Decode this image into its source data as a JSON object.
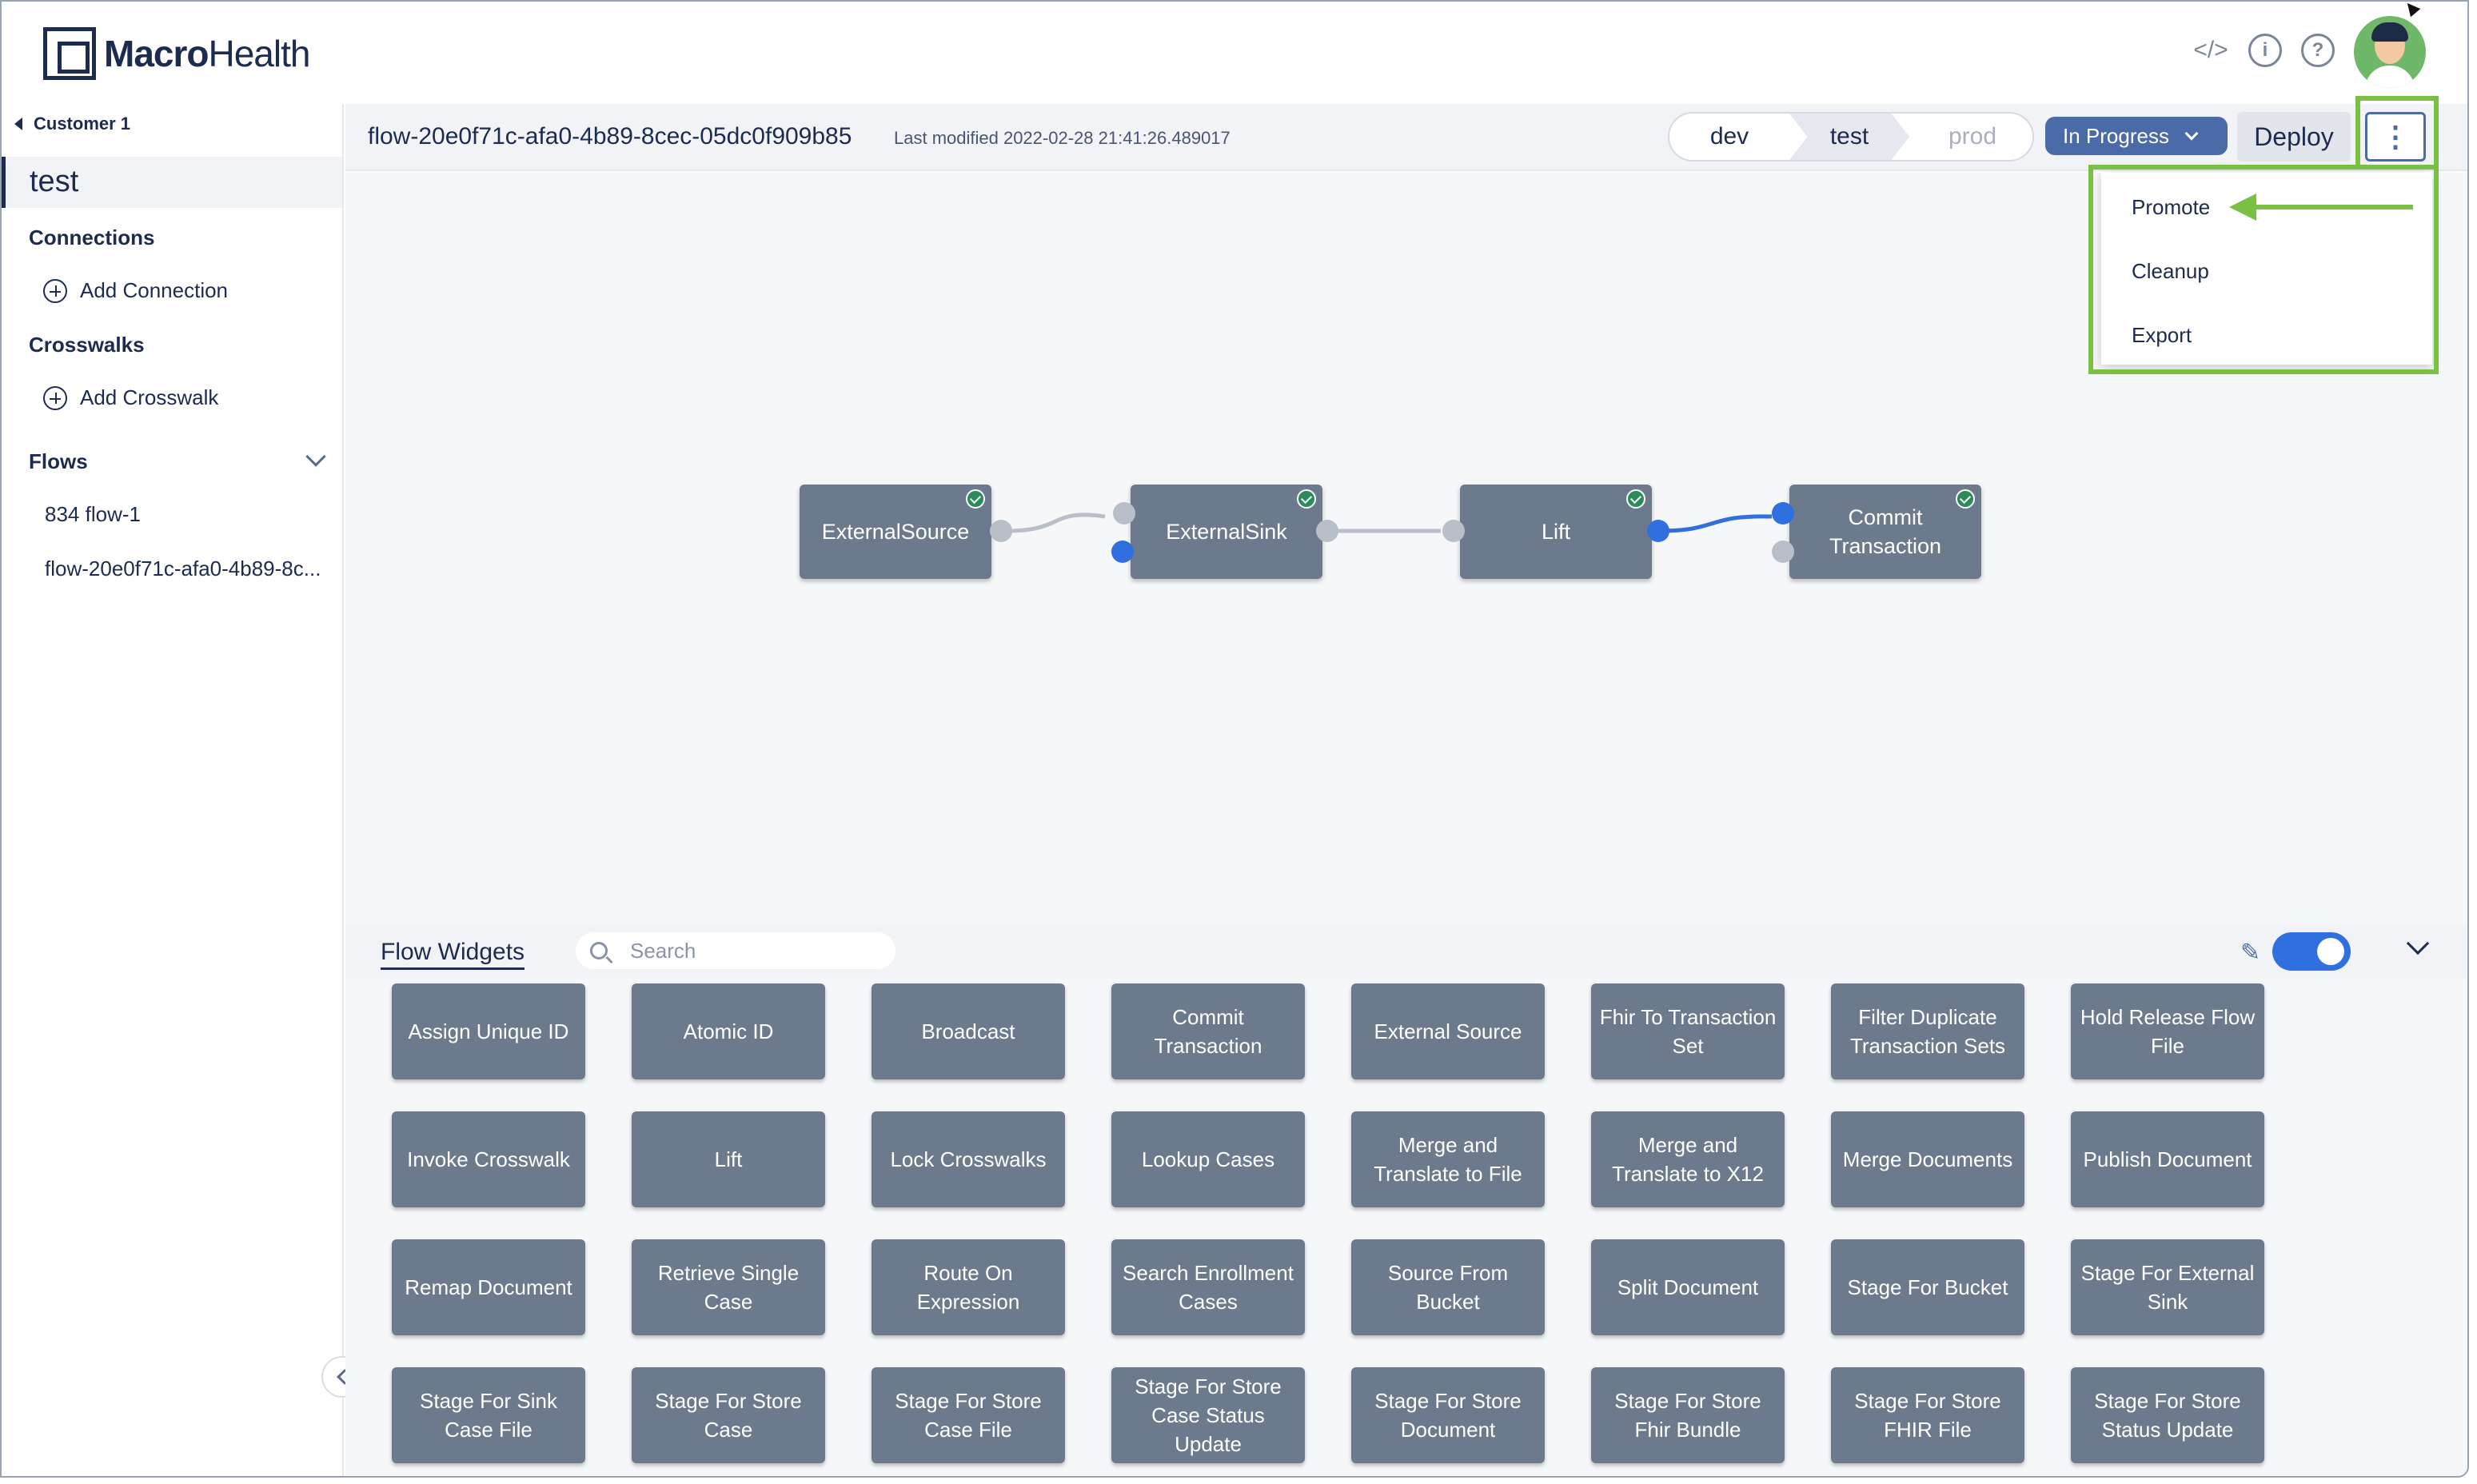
{
  "header": {
    "logo_text_bold": "Macro",
    "logo_text_light": "Health"
  },
  "sidebar": {
    "customer": "Customer 1",
    "active_item": "test",
    "connections_heading": "Connections",
    "add_connection": "Add Connection",
    "crosswalks_heading": "Crosswalks",
    "add_crosswalk": "Add Crosswalk",
    "flows_heading": "Flows",
    "flows": [
      "834 flow-1",
      "flow-20e0f71c-afa0-4b89-8c..."
    ]
  },
  "toolbar": {
    "flow_id": "flow-20e0f71c-afa0-4b89-8cec-05dc0f909b85",
    "last_modified": "Last modified 2022-02-28 21:41:26.489017",
    "env": {
      "dev": "dev",
      "test": "test",
      "prod": "prod"
    },
    "status": "In Progress",
    "deploy": "Deploy",
    "kebab": "⋮"
  },
  "menu": {
    "items": [
      "Promote",
      "Cleanup",
      "Export"
    ]
  },
  "canvas": {
    "nodes": [
      {
        "label": "ExternalSource"
      },
      {
        "label": "ExternalSink"
      },
      {
        "label": "Lift"
      },
      {
        "label": "Commit Transaction"
      }
    ]
  },
  "widgets": {
    "title": "Flow Widgets",
    "search_placeholder": "Search",
    "items": [
      "Assign Unique ID",
      "Atomic ID",
      "Broadcast",
      "Commit Transaction",
      "External Source",
      "Fhir To Transaction Set",
      "Filter Duplicate Transaction Sets",
      "Hold Release Flow File",
      "Invoke Crosswalk",
      "Lift",
      "Lock Crosswalks",
      "Lookup Cases",
      "Merge and Translate to File",
      "Merge and Translate to X12",
      "Merge Documents",
      "Publish Document",
      "Remap Document",
      "Retrieve Single Case",
      "Route On Expression",
      "Search Enrollment Cases",
      "Source From Bucket",
      "Split Document",
      "Stage For Bucket",
      "Stage For External Sink",
      "Stage For Sink Case File",
      "Stage For Store Case",
      "Stage For Store Case File",
      "Stage For Store Case Status Update",
      "Stage For Store Document",
      "Stage For Store Fhir Bundle",
      "Stage For Store FHIR File",
      "Stage For Store Status Update"
    ]
  },
  "colors": {
    "primary": "#1d2b4f",
    "accent_blue": "#4b6aa8",
    "node_gray": "#6d7a8d",
    "highlight_green": "#7ac143",
    "toggle_blue": "#2f6fe0"
  }
}
